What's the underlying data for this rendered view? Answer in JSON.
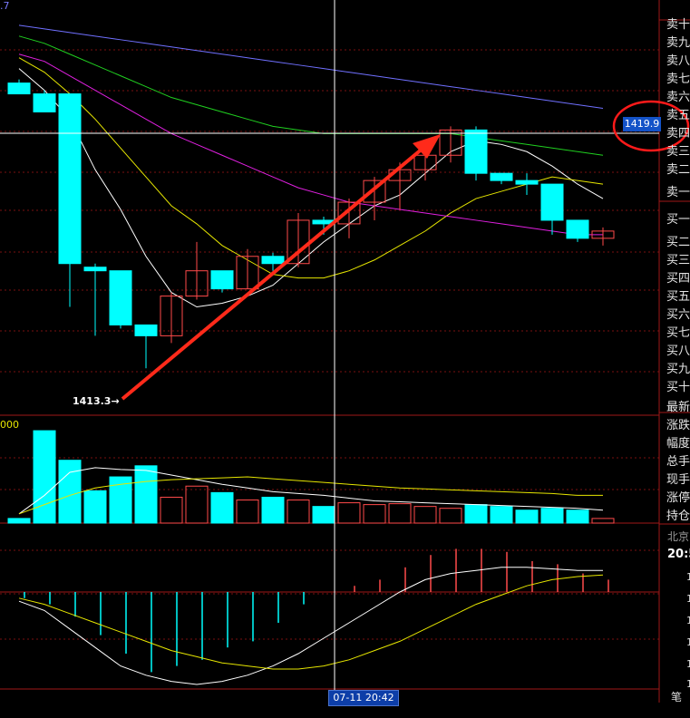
{
  "labels": {
    "top_indicator_suffix": ".7",
    "volume_indicator": "000",
    "low_price": "1413.3",
    "crosshair_price": "1419.9",
    "crosshair_time": "07-11 20:42",
    "beijing": "北京",
    "clock_partial": "20:5",
    "bi": "笔"
  },
  "side_panel": {
    "sell": [
      "卖十",
      "卖九",
      "卖八",
      "卖七",
      "卖六",
      "卖五",
      "卖四",
      "卖三",
      "卖二",
      "卖一"
    ],
    "buy": [
      "买一",
      "买二",
      "买三",
      "买四",
      "买五",
      "买六",
      "买七",
      "买八",
      "买九",
      "买十"
    ],
    "stats": [
      "最新",
      "涨跌",
      "幅度",
      "总手",
      "现手",
      "涨停",
      "持仓"
    ],
    "digits": [
      "1",
      "1",
      "1",
      "1",
      "1",
      "1"
    ]
  },
  "colors": {
    "up": "#ff4a4a",
    "down": "#00ffff",
    "ma_white": "#ffffff",
    "ma_yellow": "#e6e600",
    "ma_magenta": "#e020e0",
    "ma_green": "#20d020",
    "ma_blue": "#7070ff",
    "grid": "#7a1010",
    "arrow": "#ff2a1a",
    "circle": "#ff1a1a"
  },
  "chart_data": {
    "type": "candlestick",
    "price_axis": {
      "min": 1412.0,
      "max": 1423.5
    },
    "candles": [
      {
        "o": 1421.2,
        "h": 1421.3,
        "l": 1420.9,
        "c": 1420.9
      },
      {
        "o": 1420.9,
        "h": 1421.0,
        "l": 1420.4,
        "c": 1420.4
      },
      {
        "o": 1420.9,
        "h": 1420.9,
        "l": 1415.0,
        "c": 1416.2
      },
      {
        "o": 1416.1,
        "h": 1416.2,
        "l": 1414.2,
        "c": 1416.0
      },
      {
        "o": 1416.0,
        "h": 1416.0,
        "l": 1414.4,
        "c": 1414.5
      },
      {
        "o": 1414.5,
        "h": 1414.5,
        "l": 1413.3,
        "c": 1414.2
      },
      {
        "o": 1414.2,
        "h": 1415.4,
        "l": 1414.0,
        "c": 1415.3
      },
      {
        "o": 1415.3,
        "h": 1416.8,
        "l": 1415.2,
        "c": 1416.0
      },
      {
        "o": 1416.0,
        "h": 1416.0,
        "l": 1415.4,
        "c": 1415.5
      },
      {
        "o": 1415.5,
        "h": 1416.6,
        "l": 1415.5,
        "c": 1416.4
      },
      {
        "o": 1416.4,
        "h": 1416.5,
        "l": 1416.0,
        "c": 1416.2
      },
      {
        "o": 1416.2,
        "h": 1417.6,
        "l": 1416.1,
        "c": 1417.4
      },
      {
        "o": 1417.4,
        "h": 1417.5,
        "l": 1417.0,
        "c": 1417.3
      },
      {
        "o": 1417.3,
        "h": 1418.0,
        "l": 1416.9,
        "c": 1417.9
      },
      {
        "o": 1417.9,
        "h": 1418.6,
        "l": 1417.4,
        "c": 1418.5
      },
      {
        "o": 1418.5,
        "h": 1419.0,
        "l": 1417.7,
        "c": 1418.8
      },
      {
        "o": 1418.8,
        "h": 1419.4,
        "l": 1418.5,
        "c": 1419.2
      },
      {
        "o": 1419.2,
        "h": 1420.0,
        "l": 1419.0,
        "c": 1419.9
      },
      {
        "o": 1419.9,
        "h": 1420.0,
        "l": 1418.5,
        "c": 1418.7
      },
      {
        "o": 1418.7,
        "h": 1418.7,
        "l": 1418.4,
        "c": 1418.5
      },
      {
        "o": 1418.5,
        "h": 1418.7,
        "l": 1418.1,
        "c": 1418.4
      },
      {
        "o": 1418.4,
        "h": 1418.4,
        "l": 1417.0,
        "c": 1417.4
      },
      {
        "o": 1417.4,
        "h": 1417.4,
        "l": 1416.8,
        "c": 1416.9
      },
      {
        "o": 1416.9,
        "h": 1417.2,
        "l": 1416.7,
        "c": 1417.1
      }
    ],
    "ma": {
      "white": [
        1421.6,
        1421.0,
        1420.2,
        1418.8,
        1417.7,
        1416.4,
        1415.4,
        1415.0,
        1415.1,
        1415.3,
        1415.6,
        1416.2,
        1416.8,
        1417.3,
        1417.8,
        1418.1,
        1418.7,
        1419.3,
        1419.6,
        1419.5,
        1419.3,
        1418.9,
        1418.4,
        1418.0
      ],
      "yellow": [
        1421.9,
        1421.5,
        1420.9,
        1420.2,
        1419.4,
        1418.6,
        1417.8,
        1417.3,
        1416.7,
        1416.3,
        1415.9,
        1415.8,
        1415.8,
        1416.0,
        1416.3,
        1416.7,
        1417.1,
        1417.6,
        1418.0,
        1418.2,
        1418.4,
        1418.6,
        1418.5,
        1418.4
      ],
      "magenta": [
        1422.0,
        1421.8,
        1421.4,
        1421.0,
        1420.6,
        1420.2,
        1419.8,
        1419.5,
        1419.2,
        1418.9,
        1418.6,
        1418.3,
        1418.1,
        1417.9,
        1417.8,
        1417.7,
        1417.6,
        1417.5,
        1417.4,
        1417.3,
        1417.2,
        1417.1,
        1417.0,
        1417.0
      ],
      "green": [
        1422.5,
        1422.3,
        1422.0,
        1421.7,
        1421.4,
        1421.1,
        1420.8,
        1420.6,
        1420.4,
        1420.2,
        1420.0,
        1419.9,
        1419.8,
        1419.8,
        1419.8,
        1419.8,
        1419.8,
        1419.8,
        1419.7,
        1419.6,
        1419.5,
        1419.4,
        1419.3,
        1419.2
      ],
      "blue": [
        1422.8,
        1422.7,
        1422.6,
        1422.5,
        1422.4,
        1422.3,
        1422.2,
        1422.1,
        1422.0,
        1421.9,
        1421.8,
        1421.7,
        1421.6,
        1421.5,
        1421.4,
        1421.3,
        1421.2,
        1421.1,
        1421.0,
        1420.9,
        1420.8,
        1420.7,
        1420.6,
        1420.5
      ]
    },
    "volume": [
      5,
      100,
      68,
      35,
      50,
      62,
      28,
      40,
      33,
      25,
      28,
      25,
      18,
      22,
      20,
      21,
      18,
      16,
      20,
      18,
      14,
      16,
      14,
      5
    ],
    "volume_ma_white": [
      10,
      30,
      55,
      60,
      58,
      57,
      52,
      47,
      42,
      38,
      34,
      32,
      30,
      27,
      24,
      23,
      22,
      21,
      20,
      19,
      18,
      17,
      16,
      14
    ],
    "volume_ma_yellow": [
      10,
      20,
      30,
      38,
      42,
      45,
      47,
      48,
      49,
      50,
      48,
      46,
      44,
      42,
      40,
      38,
      37,
      36,
      35,
      34,
      33,
      32,
      30,
      30
    ],
    "macd_hist": [
      -0.2,
      -0.4,
      -0.8,
      -1.4,
      -2.0,
      -2.6,
      -2.4,
      -2.2,
      -1.8,
      -1.6,
      -1.0,
      -0.4,
      0.0,
      0.2,
      0.4,
      0.8,
      1.2,
      1.4,
      1.4,
      1.3,
      1.0,
      0.9,
      0.6,
      0.4
    ],
    "macd_white": [
      -0.3,
      -0.6,
      -1.2,
      -1.8,
      -2.4,
      -2.7,
      -2.9,
      -3.0,
      -2.9,
      -2.7,
      -2.4,
      -2.0,
      -1.5,
      -1.0,
      -0.5,
      0.0,
      0.4,
      0.6,
      0.7,
      0.8,
      0.8,
      0.75,
      0.7,
      0.7
    ],
    "macd_yellow": [
      -0.2,
      -0.4,
      -0.7,
      -1.0,
      -1.3,
      -1.6,
      -1.9,
      -2.1,
      -2.3,
      -2.4,
      -2.5,
      -2.5,
      -2.4,
      -2.2,
      -1.9,
      -1.6,
      -1.2,
      -0.8,
      -0.4,
      -0.1,
      0.2,
      0.4,
      0.5,
      0.55
    ]
  }
}
